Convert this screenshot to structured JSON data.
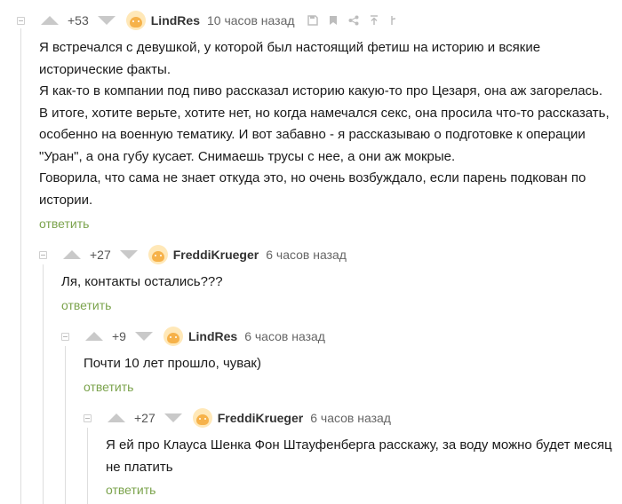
{
  "comments": [
    {
      "rating": "+53",
      "author": "LindRes",
      "time": "10 часов назад",
      "paragraphs": [
        "Я встречался с девушкой, у которой был настоящий фетиш на историю и всякие исторические факты.",
        "Я как-то в компании под пиво рассказал историю какую-то про Цезаря, она аж загорелась.",
        "В итоге, хотите верьте, хотите нет, но когда намечался секс, она просила что-то рассказать, особенно на военную тематику. И вот забавно - я рассказываю о подготовке к операции \"Уран\", а она губу кусает. Снимаешь трусы с нее, а они аж мокрые.",
        "Говорила, что сама не знает откуда это, но очень возбуждало, если парень подкован по истории."
      ],
      "reply_label": "ответить",
      "tools": [
        "save-icon",
        "bookmark-icon",
        "share-icon",
        "go-to-parent-icon",
        "thread-icon"
      ]
    },
    {
      "rating": "+27",
      "author": "FreddiKrueger",
      "time": "6 часов назад",
      "paragraphs": [
        "Ля, контакты остались???"
      ],
      "reply_label": "ответить"
    },
    {
      "rating": "+9",
      "author": "LindRes",
      "time": "6 часов назад",
      "paragraphs": [
        "Почти 10 лет прошло, чувак)"
      ],
      "reply_label": "ответить"
    },
    {
      "rating": "+27",
      "author": "FreddiKrueger",
      "time": "6 часов назад",
      "paragraphs": [
        "Я ей про Клауса Шенка Фон Штауфенберга расскажу, за воду можно будет месяц не платить"
      ],
      "reply_label": "ответить"
    }
  ],
  "colors": {
    "reply_link": "#7ba34c",
    "vote_arrow": "#c9c9c9",
    "thread_line": "#dedede",
    "avatar_bg": "#ffe8b8",
    "avatar_face": "#f6b24a"
  }
}
